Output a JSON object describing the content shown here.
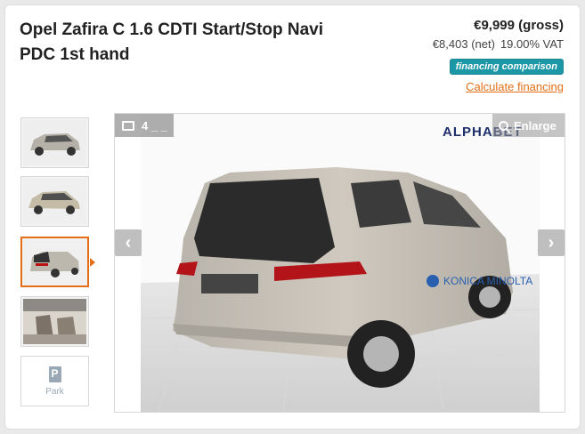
{
  "listing": {
    "title": "Opel Zafira C 1.6 CDTI Start/Stop Navi PDC 1st hand",
    "price_gross": "€9,999 (gross)",
    "price_net": "€8,403 (net)",
    "vat": "19.00% VAT",
    "financing_badge": "financing comparison",
    "calculate_link": "Calculate financing"
  },
  "gallery": {
    "image_counter": "4 _ _",
    "enlarge_label": "Enlarge",
    "brand_watermark": "ALPHABET",
    "prev_icon": "chevron-left-icon",
    "next_icon": "chevron-right-icon",
    "thumbnails": [
      {
        "label": "thumbnail-1"
      },
      {
        "label": "thumbnail-2"
      },
      {
        "label": "thumbnail-3"
      },
      {
        "label": "thumbnail-4"
      }
    ],
    "park_label": "Park",
    "park_icon": "P"
  },
  "colors": {
    "accent": "#e36e17",
    "badge": "#1c97a6"
  }
}
